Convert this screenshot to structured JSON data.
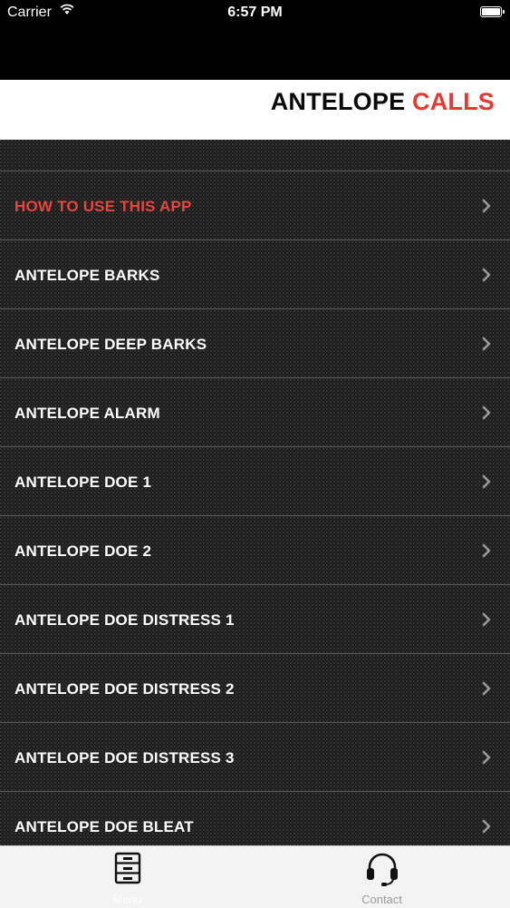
{
  "status": {
    "carrier": "Carrier",
    "time": "6:57 PM"
  },
  "header": {
    "title_main": "ANTELOPE ",
    "title_accent": "CALLS"
  },
  "list": {
    "items": [
      {
        "label": "HOW TO USE THIS APP"
      },
      {
        "label": "ANTELOPE BARKS"
      },
      {
        "label": "ANTELOPE DEEP BARKS"
      },
      {
        "label": "ANTELOPE ALARM"
      },
      {
        "label": "ANTELOPE DOE 1"
      },
      {
        "label": "ANTELOPE DOE 2"
      },
      {
        "label": "ANTELOPE DOE DISTRESS 1"
      },
      {
        "label": "ANTELOPE DOE DISTRESS 2"
      },
      {
        "label": "ANTELOPE DOE DISTRESS 3"
      },
      {
        "label": "ANTELOPE DOE BLEAT"
      }
    ]
  },
  "tabbar": {
    "tabs": [
      {
        "label": "Menu",
        "icon": "cabinet-icon"
      },
      {
        "label": "Contact",
        "icon": "headset-icon"
      }
    ]
  },
  "colors": {
    "accent": "#e23b34",
    "header_bg": "#ffffff",
    "list_bg": "#1b1b1b"
  }
}
